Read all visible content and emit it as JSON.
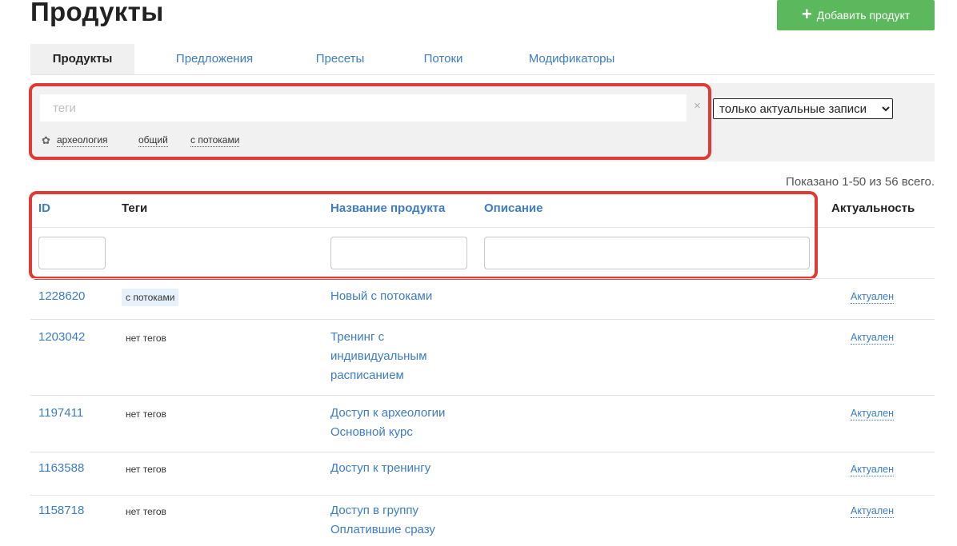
{
  "page": {
    "title": "Продукты",
    "add_button_label": "Добавить продукт",
    "accent_color": "#5cb85c",
    "link_color": "#3c7dc4",
    "highlight_color": "#e03a34"
  },
  "tabs": [
    {
      "label": "Продукты",
      "active": true
    },
    {
      "label": "Предложения",
      "active": false
    },
    {
      "label": "Пресеты",
      "active": false
    },
    {
      "label": "Потоки",
      "active": false
    },
    {
      "label": "Модификаторы",
      "active": false
    }
  ],
  "filter": {
    "tags_placeholder": "теги",
    "tags_value": "",
    "clear_symbol": "×",
    "quick_tags": [
      "археология",
      "общий",
      "с потоками"
    ],
    "status_selected": "только актуальные записи"
  },
  "summary": "Показано 1-50 из 56 всего.",
  "table": {
    "columns": {
      "id": "ID",
      "tags": "Теги",
      "name": "Название продукта",
      "description": "Описание",
      "status": "Актуальность"
    },
    "rows": [
      {
        "id": "1228620",
        "tags": "с потоками",
        "name": "Новый с потоками",
        "status": "Актуален"
      },
      {
        "id": "1203042",
        "tags": "нет тегов",
        "name": "Тренинг с индивидуальным расписанием",
        "status": "Актуален"
      },
      {
        "id": "1197411",
        "tags": "нет тегов",
        "name": "Доступ к археологии Основной курс",
        "status": "Актуален"
      },
      {
        "id": "1163588",
        "tags": "нет тегов",
        "name": "Доступ к тренингу",
        "status": "Актуален"
      },
      {
        "id": "1158718",
        "tags": "нет тегов",
        "name": "Доступ в группу Оплатившие сразу",
        "status": "Актуален"
      }
    ]
  }
}
